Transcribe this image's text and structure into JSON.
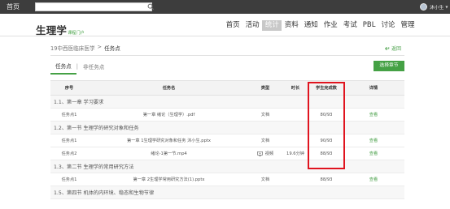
{
  "topbar": {
    "home": "首页",
    "user_name": "沐小生",
    "user_caret": "▼"
  },
  "brand": {
    "main": "生理学",
    "sub": "课程门户"
  },
  "nav": [
    "首页",
    "活动",
    "统计",
    "资料",
    "通知",
    "作业",
    "考试",
    "PBL",
    "讨论",
    "管理"
  ],
  "nav_active": "统计",
  "breadcrumb": {
    "class_name": "19中西医临床医学",
    "separator": ">",
    "current": "任务点"
  },
  "back_label": "返回",
  "tabs": {
    "done": "任务点",
    "separator": "|",
    "other": "非任务点"
  },
  "select_chapter": "选择章节",
  "table": {
    "headers": {
      "no": "序号",
      "name": "任务名",
      "type": "类型",
      "duration": "时长",
      "completed": "学生完成数",
      "detail": "详情"
    },
    "rows": [
      {
        "kind": "section",
        "title": "1.1、第一章 学习要求"
      },
      {
        "kind": "task",
        "no": "任务点1",
        "name": "第一章 绪论（生理学）.pdf",
        "type": "文档",
        "duration": "",
        "completed": "80/93",
        "detail": "查看"
      },
      {
        "kind": "section",
        "title": "1.2、第一节 生理学的研究对象和任务"
      },
      {
        "kind": "task",
        "no": "任务点1",
        "name": "第一章 1生理学研究对象和任务 沐小生.pptx",
        "type": "文档",
        "duration": "",
        "completed": "90/93",
        "detail": "查看"
      },
      {
        "kind": "task",
        "no": "任务点2",
        "name": "绪论-1第一节.mp4",
        "type": "视频",
        "duration": "19.6分钟",
        "completed": "88/93",
        "detail": "查看"
      },
      {
        "kind": "section",
        "title": "1.3、第二节 生理学的常用研究方法"
      },
      {
        "kind": "task",
        "no": "任务点1",
        "name": "第一章 2生理学常用研究方法(1).pptx",
        "type": "文档",
        "duration": "",
        "completed": "88/93",
        "detail": "查看"
      },
      {
        "kind": "section",
        "title": "1.5、第四节 机体的内环境、稳态和生物节律"
      }
    ]
  },
  "colors": {
    "accent": "#45a145",
    "highlight": "#e0141f",
    "topbar": "#3d3d3d"
  }
}
